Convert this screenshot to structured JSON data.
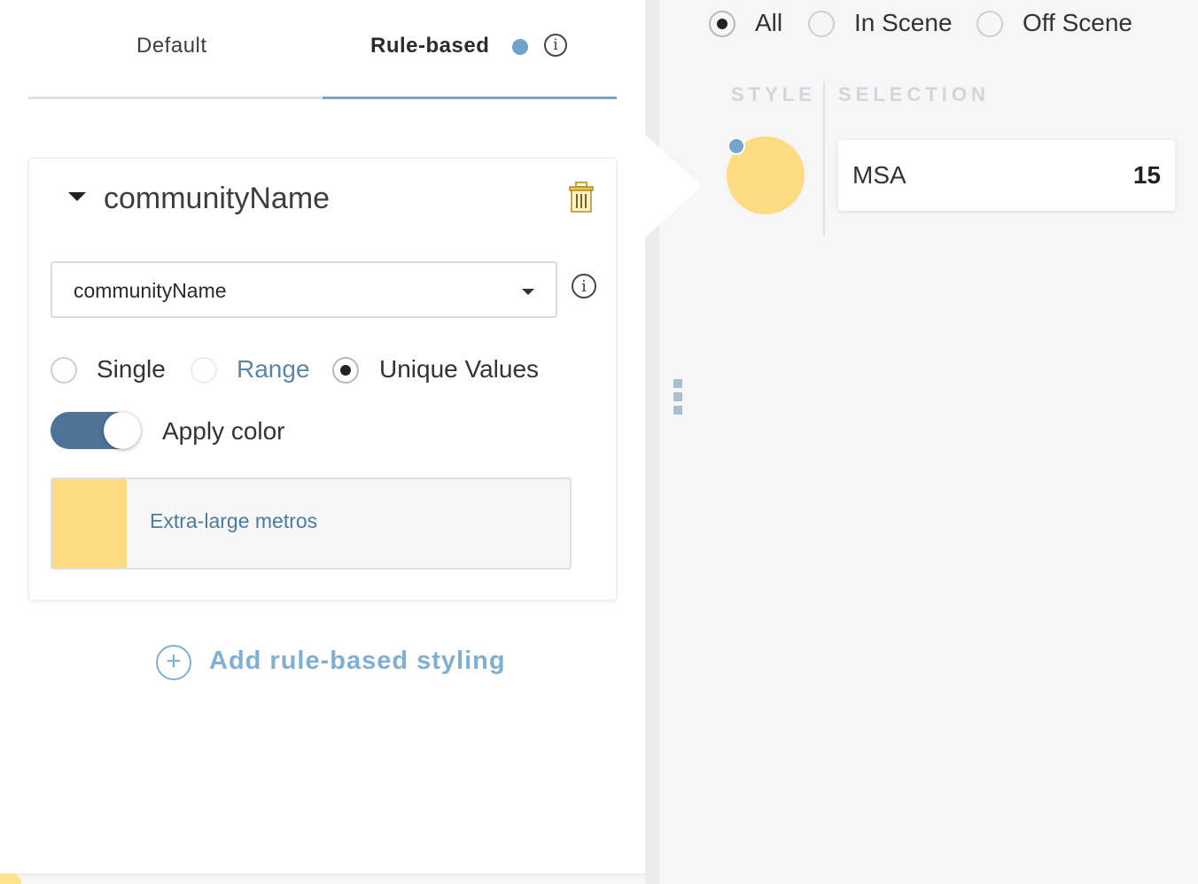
{
  "tabs": {
    "default_label": "Default",
    "rule_label": "Rule-based",
    "active": "Rule-based"
  },
  "rule": {
    "title": "communityName",
    "field_value": "communityName",
    "modes": [
      "Single",
      "Range",
      "Unique Values"
    ],
    "selected_mode": "Unique Values",
    "apply_color_label": "Apply color",
    "apply_color_on": true,
    "color_entries": [
      {
        "label": "Extra-large metros",
        "color": "#fddb82"
      }
    ]
  },
  "add_rule_label": "Add rule-based styling",
  "scope": {
    "options": [
      "All",
      "In Scene",
      "Off Scene"
    ],
    "selected": "All"
  },
  "table": {
    "style_header": "STYLE",
    "selection_header": "SELECTION",
    "rows": [
      {
        "label": "MSA",
        "count": "15",
        "color": "#fddb82",
        "marker_color": "#72a6cd"
      }
    ]
  },
  "colors": {
    "accent": "#78a7c6",
    "toggle": "#4e7396",
    "link": "#7fb0d3",
    "swatch": "#fddb82"
  }
}
